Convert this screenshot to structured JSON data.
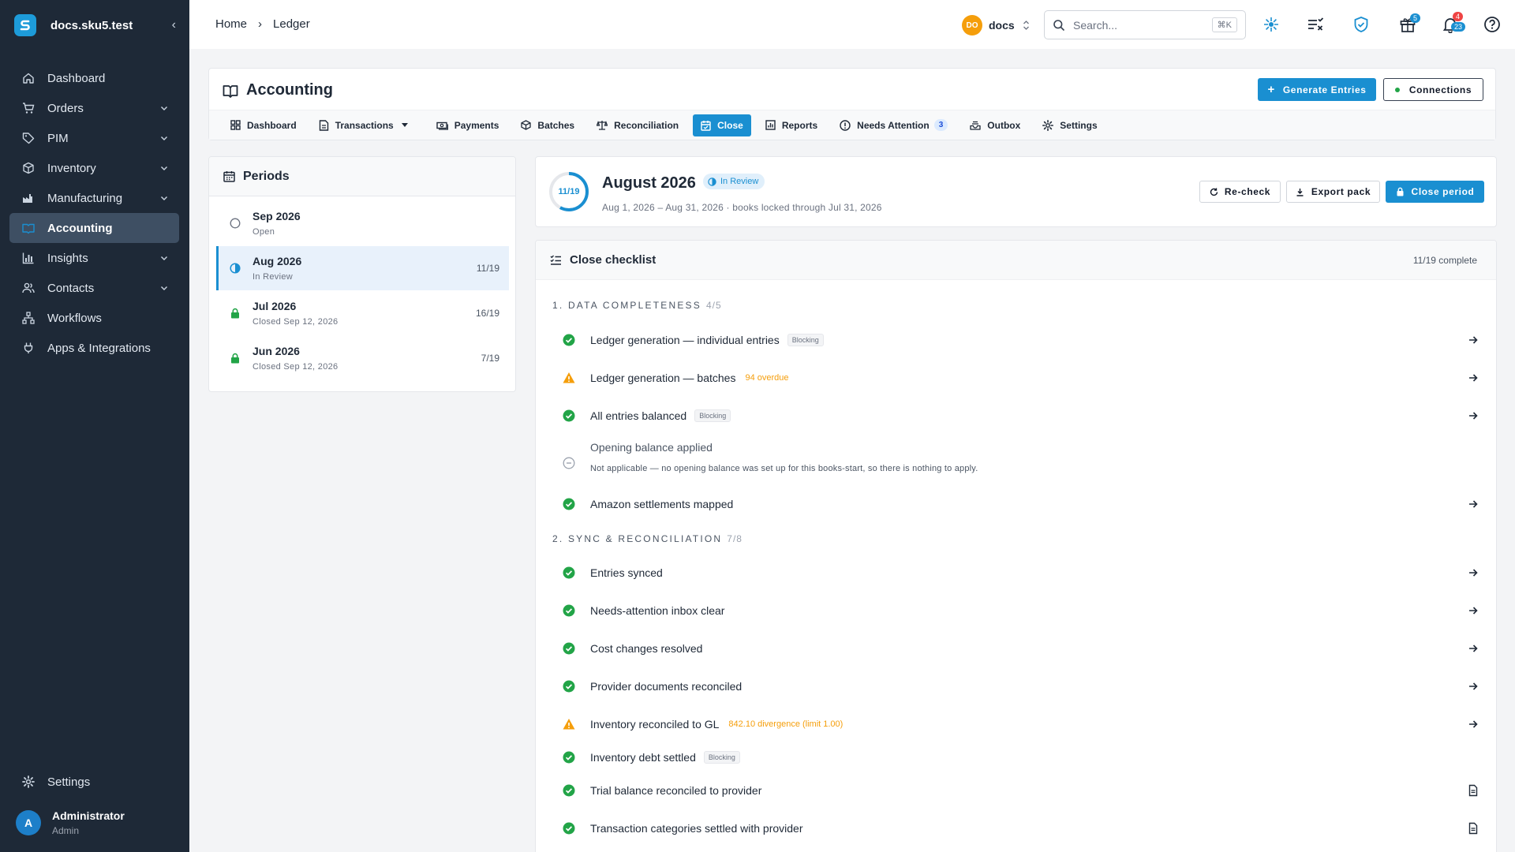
{
  "app": {
    "name": "docs.sku5.test"
  },
  "sidebar": {
    "items": [
      {
        "label": "Dashboard"
      },
      {
        "label": "Orders"
      },
      {
        "label": "PIM"
      },
      {
        "label": "Inventory"
      },
      {
        "label": "Manufacturing"
      },
      {
        "label": "Accounting"
      },
      {
        "label": "Insights"
      },
      {
        "label": "Contacts"
      },
      {
        "label": "Workflows"
      },
      {
        "label": "Apps & Integrations"
      }
    ],
    "settings": "Settings",
    "user": {
      "initial": "A",
      "name": "Administrator",
      "role": "Admin"
    }
  },
  "header": {
    "breadcrumb": [
      "Home",
      "›",
      "Ledger"
    ],
    "workspace": {
      "initials": "DO",
      "name": "docs"
    },
    "search": {
      "placeholder": "Search...",
      "shortcut": "⌘K"
    },
    "gift_badge": "5",
    "notif_badge_red": "4",
    "notif_badge_blue": "23"
  },
  "page": {
    "title": "Accounting",
    "generate_label": "Generate Entries",
    "connections_label": "Connections",
    "tabs": [
      {
        "label": "Dashboard"
      },
      {
        "label": "Transactions"
      },
      {
        "label": "Payments"
      },
      {
        "label": "Batches"
      },
      {
        "label": "Reconciliation"
      },
      {
        "label": "Close"
      },
      {
        "label": "Reports"
      },
      {
        "label": "Needs Attention",
        "count": "3"
      },
      {
        "label": "Outbox"
      },
      {
        "label": "Settings"
      }
    ]
  },
  "periods": {
    "title": "Periods",
    "list": [
      {
        "name": "Sep 2026",
        "status": "Open",
        "count": ""
      },
      {
        "name": "Aug 2026",
        "status": "In Review",
        "count": "11/19"
      },
      {
        "name": "Jul 2026",
        "status": "Closed Sep 12, 2026",
        "count": "16/19"
      },
      {
        "name": "Jun 2026",
        "status": "Closed Sep 12, 2026",
        "count": "7/19"
      }
    ]
  },
  "detail": {
    "progress": "11/19",
    "progress_fraction": 0.579,
    "title": "August 2026",
    "status": "In Review",
    "subtitle": "Aug 1, 2026 – Aug 31, 2026 · books locked through Jul 31, 2026",
    "recheck_label": "Re-check",
    "export_label": "Export pack",
    "close_label": "Close period"
  },
  "checklist": {
    "title": "Close checklist",
    "complete": "11/19 complete",
    "sections": [
      {
        "title": "1. DATA COMPLETENESS",
        "count": "4/5",
        "items": [
          {
            "label": "Ledger generation — individual entries",
            "tag": "Blocking",
            "state": "done"
          },
          {
            "label": "Ledger generation — batches",
            "warn": "94 overdue",
            "state": "warn"
          },
          {
            "label": "All entries balanced",
            "tag": "Blocking",
            "state": "done"
          },
          {
            "label": "Opening balance applied",
            "desc": "Not applicable — no opening balance was set up for this books-start, so there is nothing to apply.",
            "state": "na"
          },
          {
            "label": "Amazon settlements mapped",
            "state": "done"
          }
        ]
      },
      {
        "title": "2. SYNC & RECONCILIATION",
        "count": "7/8",
        "items": [
          {
            "label": "Entries synced",
            "state": "done"
          },
          {
            "label": "Needs-attention inbox clear",
            "state": "done"
          },
          {
            "label": "Cost changes resolved",
            "state": "done"
          },
          {
            "label": "Provider documents reconciled",
            "state": "done"
          },
          {
            "label": "Inventory reconciled to GL",
            "warn": "842.10 divergence (limit 1.00)",
            "state": "warn"
          },
          {
            "label": "Inventory debt settled",
            "tag": "Blocking",
            "state": "done"
          },
          {
            "label": "Trial balance reconciled to provider",
            "state": "done"
          },
          {
            "label": "Transaction categories settled with provider",
            "state": "done"
          }
        ]
      }
    ]
  },
  "colors": {
    "accent": "#1a8fd1",
    "sidebar": "#1e2937",
    "success": "#22a447",
    "warning": "#f59e0b"
  }
}
